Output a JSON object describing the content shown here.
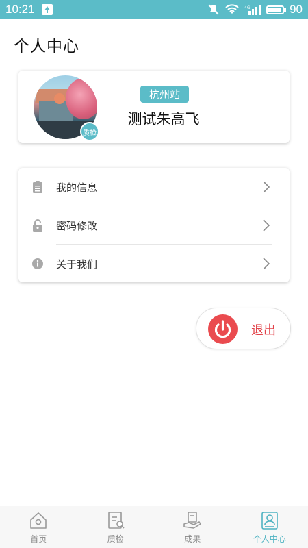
{
  "status_bar": {
    "time": "10:21",
    "signal_label": "4G",
    "battery_level": "90"
  },
  "header": {
    "title": "个人中心"
  },
  "profile": {
    "badge": "质检",
    "station": "杭州站",
    "name": "测试朱高飞"
  },
  "menu": {
    "items": [
      {
        "label": "我的信息",
        "icon": "clipboard-icon"
      },
      {
        "label": "密码修改",
        "icon": "lock-icon"
      },
      {
        "label": "关于我们",
        "icon": "info-icon"
      }
    ]
  },
  "logout": {
    "label": "退出"
  },
  "bottom_nav": {
    "items": [
      {
        "label": "首页",
        "icon": "home-icon"
      },
      {
        "label": "质检",
        "icon": "inspection-icon"
      },
      {
        "label": "成果",
        "icon": "results-icon"
      },
      {
        "label": "个人中心",
        "icon": "profile-icon",
        "active": true
      }
    ]
  },
  "colors": {
    "accent": "#5bbcc8",
    "logout_red": "#ea4b4f",
    "nav_active": "#4fb3c2"
  }
}
